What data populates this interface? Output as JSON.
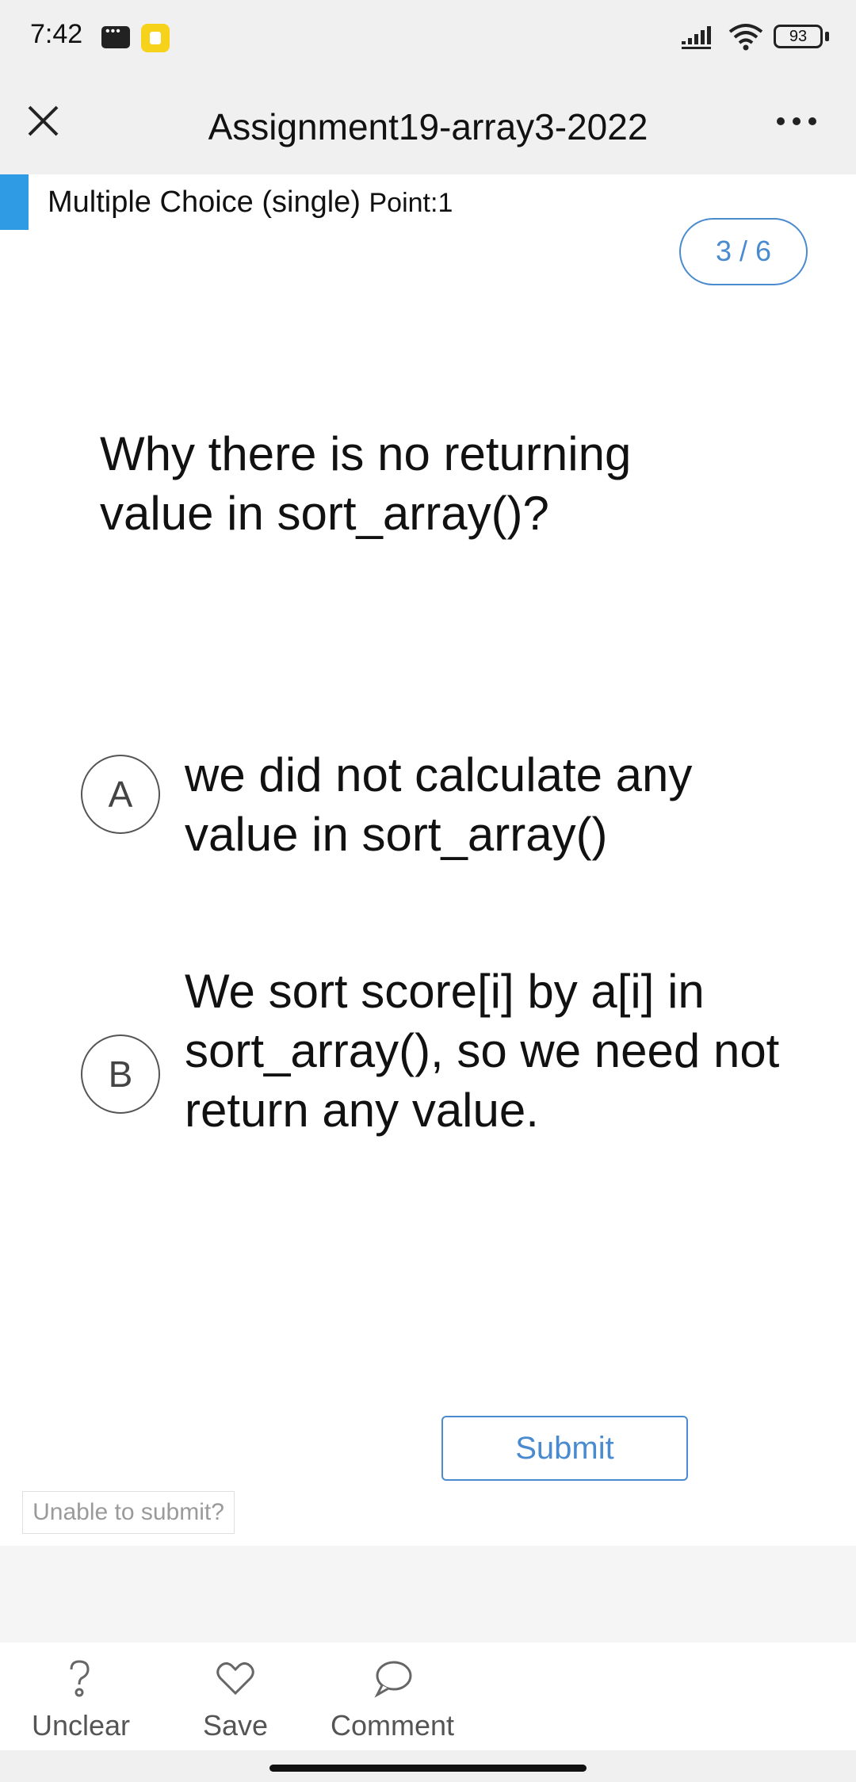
{
  "status_bar": {
    "time": "7:42",
    "battery": "93",
    "icons": [
      "chat-icon",
      "app-notification-icon",
      "signal-icon",
      "wifi-icon",
      "battery-icon"
    ]
  },
  "header": {
    "title": "Assignment19-array3-2022",
    "close_icon": "close-icon",
    "more_icon": "more-icon"
  },
  "question": {
    "type_label": "Multiple Choice (single)",
    "points_label": "Point:1",
    "progress": "3 / 6",
    "text": "Why there is no returning value in sort_array()?",
    "options": [
      {
        "letter": "A",
        "text": "we did not calculate any value in sort_array()"
      },
      {
        "letter": "B",
        "text": "We sort score[i] by a[i] in sort_array(), so we need not return any value."
      }
    ]
  },
  "actions": {
    "submit_label": "Submit",
    "unable_label": "Unable to submit?"
  },
  "bottom_bar": {
    "tabs": [
      {
        "label": "Unclear",
        "icon": "question-icon"
      },
      {
        "label": "Save",
        "icon": "heart-icon"
      },
      {
        "label": "Comment",
        "icon": "comment-icon"
      }
    ]
  },
  "colors": {
    "accent": "#2f9be5",
    "link_blue": "#4a8bd0",
    "header_bg": "#f0f0f0"
  }
}
